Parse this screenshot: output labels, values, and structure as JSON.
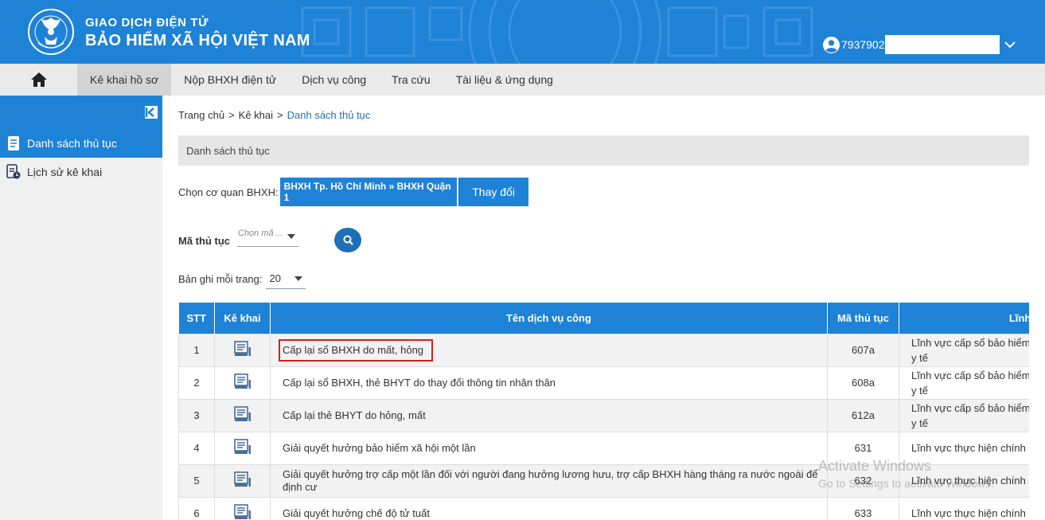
{
  "header": {
    "brand_top": "GIAO DỊCH ĐIỆN TỬ",
    "brand_main": "BẢO HIỂM XÃ HỘI VIỆT NAM",
    "user_id": "7937902",
    "colors": {
      "primary": "#1e82d7",
      "nav_bg": "#eaeaea"
    }
  },
  "nav": {
    "items": [
      {
        "label": "Kê khai hồ sơ",
        "active": true
      },
      {
        "label": "Nộp BHXH điện tử"
      },
      {
        "label": "Dịch vụ công"
      },
      {
        "label": "Tra cứu"
      },
      {
        "label": "Tài liệu & ứng dụng"
      }
    ]
  },
  "sidebar": {
    "items": [
      {
        "label": "Danh sách thủ tục",
        "icon": "document-list-icon",
        "active": true
      },
      {
        "label": "Lịch sử kê khai",
        "icon": "history-icon"
      }
    ]
  },
  "breadcrumb": {
    "home": "Trang chủ",
    "level1": "Kê khai",
    "current": "Danh sách thủ tục",
    "separator": ">"
  },
  "section": {
    "title": "Danh sách thủ tục"
  },
  "agency": {
    "label": "Chọn cơ quan BHXH:",
    "value": "BHXH Tp. Hồ Chí Minh » BHXH Quận 1",
    "change_label": "Thay đổi"
  },
  "filter": {
    "code_label": "Mã thủ tục",
    "code_placeholder": "Chọn mã ...",
    "per_page_label": "Bản ghi mỗi trang:",
    "per_page_value": "20"
  },
  "table": {
    "headers": [
      "STT",
      "Kê khai",
      "Tên dịch vụ công",
      "Mã thủ tục",
      "Lĩnh v"
    ],
    "rows": [
      {
        "stt": "1",
        "name": "Cấp lại sổ BHXH do mất, hỏng",
        "code": "607a",
        "field_line1": "Lĩnh vực cấp sổ bảo hiểm",
        "field_line2": "y tế",
        "highlight": true
      },
      {
        "stt": "2",
        "name": "Cấp lại sổ BHXH, thẻ BHYT do thay đổi thông tin nhân thân",
        "code": "608a",
        "field_line1": "Lĩnh vực cấp sổ bảo hiểm",
        "field_line2": "y tế"
      },
      {
        "stt": "3",
        "name": "Cấp lại thẻ BHYT do hỏng, mất",
        "code": "612a",
        "field_line1": "Lĩnh vực cấp sổ bảo hiểm",
        "field_line2": "y tế"
      },
      {
        "stt": "4",
        "name": "Giải quyết hưởng bảo hiểm xã hội một lần",
        "code": "631",
        "field_line1": "Lĩnh vực thực hiện chính",
        "field_line2": ""
      },
      {
        "stt": "5",
        "name": "Giải quyết hưởng trợ cấp một lần đối với người đang hưởng lương hưu, trợ cấp BHXH hàng tháng ra nước ngoài để định cư",
        "code": "632",
        "field_line1": "Lĩnh vực thực hiện chính",
        "field_line2": ""
      },
      {
        "stt": "6",
        "name": "Giải quyết hưởng chế độ tử tuất",
        "code": "633",
        "field_line1": "Lĩnh vực thực hiện chính",
        "field_line2": ""
      }
    ]
  },
  "watermark": {
    "line1": "Activate Windows",
    "line2": "Go to Settings to activate Windows."
  }
}
